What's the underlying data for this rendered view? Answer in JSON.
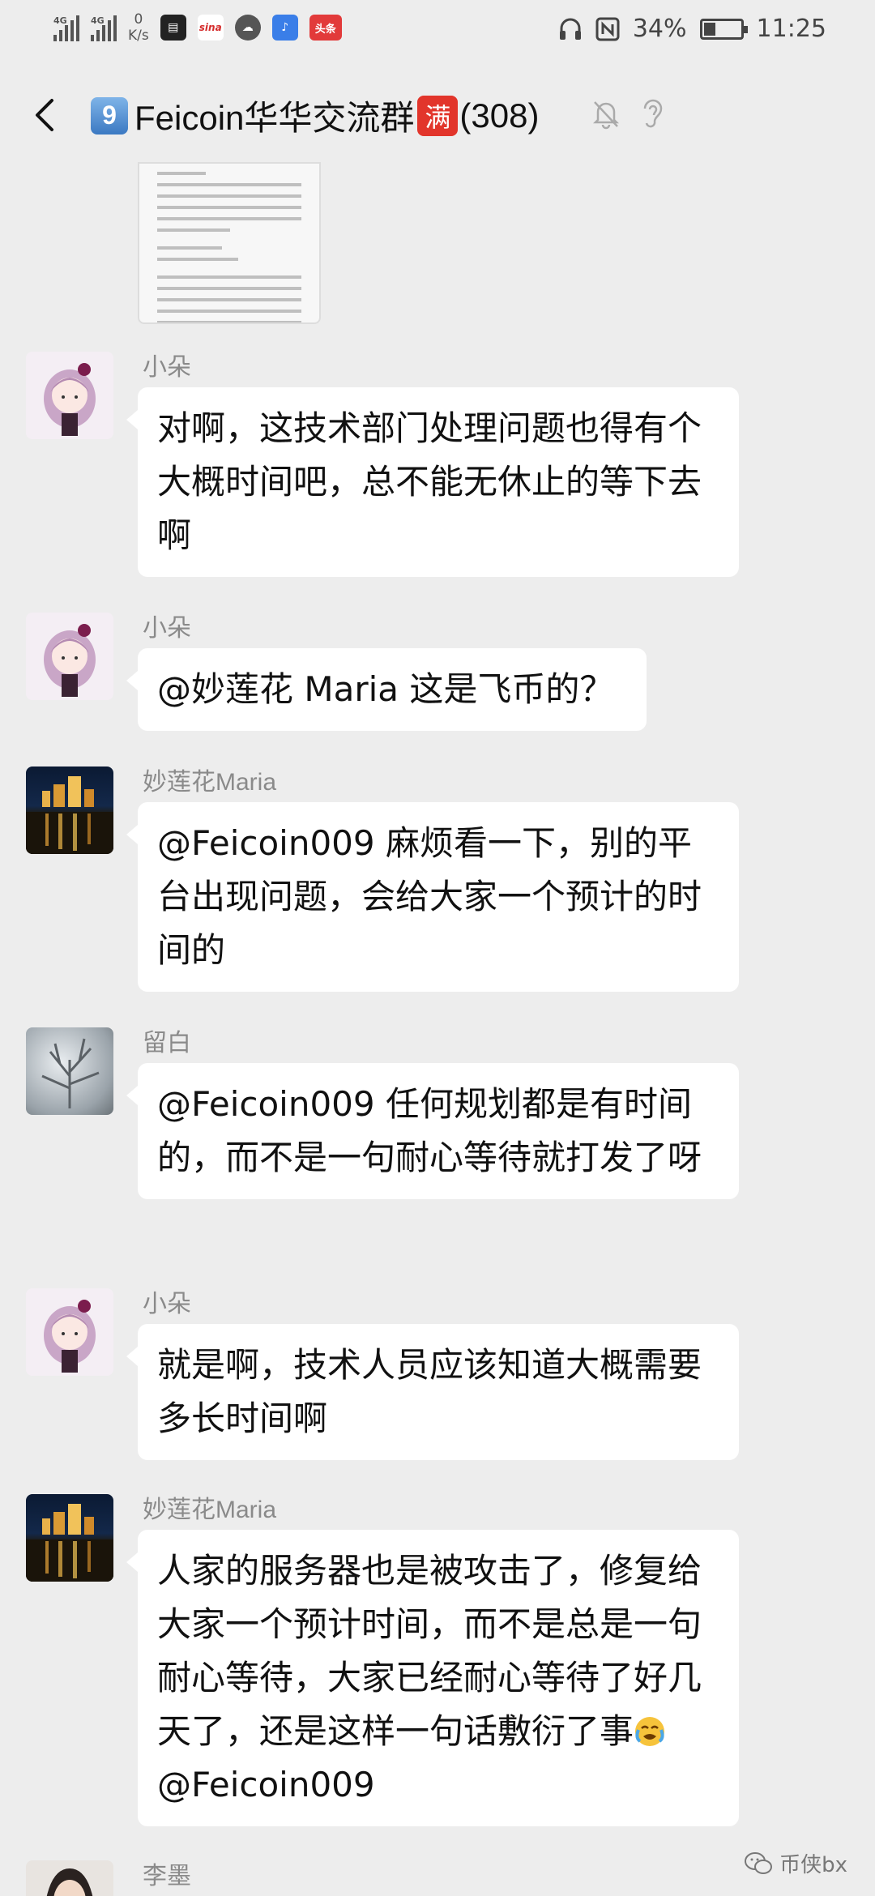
{
  "status_bar": {
    "signal1": "4G",
    "signal2": "4G",
    "speed_value": "0",
    "speed_unit": "K/s",
    "app_icons": [
      "news-icon",
      "sina-icon",
      "cloud-icon",
      "music-icon",
      "toutiao-icon"
    ],
    "toutiao_label": "头条",
    "sina_label": "sina",
    "battery_percent": "34%",
    "battery_level": 0.34,
    "time": "11:25"
  },
  "header": {
    "keycap": "9",
    "title": "Feicoin华华交流群",
    "full_badge": "满",
    "member_count": "(308)"
  },
  "messages": [
    {
      "sender": "小朵",
      "avatar": "girl-avatar",
      "text": "对啊，这技术部门处理问题也得有个大概时间吧，总不能无休止的等下去啊"
    },
    {
      "sender": "小朵",
      "avatar": "girl-avatar",
      "text": "@妙莲花 Maria  这是飞币的？"
    },
    {
      "sender": "妙莲花Maria",
      "avatar": "night-city-avatar",
      "text": "@Feicoin009  麻烦看一下，别的平台出现问题，会给大家一个预计的时间的"
    },
    {
      "sender": "留白",
      "avatar": "snow-tree-avatar",
      "text": "@Feicoin009  任何规划都是有时间的，而不是一句耐心等待就打发了呀"
    },
    {
      "sender": "小朵",
      "avatar": "girl-avatar",
      "text": "就是啊，技术人员应该知道大概需要多长时间啊"
    },
    {
      "sender": "妙莲花Maria",
      "avatar": "night-city-avatar",
      "text_before": "人家的服务器也是被攻击了，修复给大家一个预计时间，而不是总是一句耐心等待，大家已经耐心等待了好几天了，还是这样一句话敷衍了事",
      "text_after": "@Feicoin009"
    },
    {
      "sender": "李墨",
      "avatar": "woman-avatar"
    }
  ],
  "watermark": "币侠bx"
}
